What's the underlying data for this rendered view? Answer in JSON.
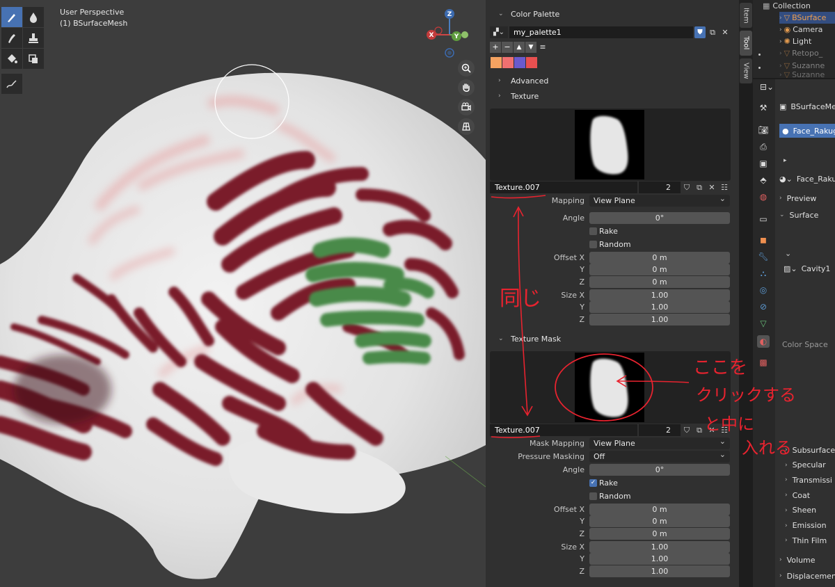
{
  "viewport": {
    "view_name": "User Perspective",
    "object_name": "(1) BSurfaceMesh",
    "gizmo": {
      "z": "Z",
      "x": "X",
      "y": "Y"
    }
  },
  "props": {
    "color_palette": {
      "header": "Color Palette",
      "palette_name": "my_palette1",
      "swatches": [
        "#f4a261",
        "#f07070",
        "#6a5acd",
        "#e85050"
      ]
    },
    "advanced": "Advanced",
    "texture": {
      "header": "Texture",
      "tex_name": "Texture.007",
      "users": "2",
      "mapping_label": "Mapping",
      "mapping_value": "View Plane",
      "angle_label": "Angle",
      "angle_value": "0°",
      "rake": "Rake",
      "random": "Random",
      "offset_x_label": "Offset X",
      "y_label": "Y",
      "z_label": "Z",
      "size_x_label": "Size X",
      "offset": [
        "0 m",
        "0 m",
        "0 m"
      ],
      "size": [
        "1.00",
        "1.00",
        "1.00"
      ]
    },
    "texture_mask": {
      "header": "Texture Mask",
      "tex_name": "Texture.007",
      "users": "2",
      "mask_mapping_label": "Mask Mapping",
      "mask_mapping_value": "View Plane",
      "pressure_label": "Pressure Masking",
      "pressure_value": "Off",
      "angle_label": "Angle",
      "angle_value": "0°",
      "rake": "Rake",
      "random": "Random",
      "offset_x_label": "Offset X",
      "y_label": "Y",
      "z_label": "Z",
      "size_x_label": "Size X",
      "offset": [
        "0 m",
        "0 m",
        "0 m"
      ],
      "size": [
        "1.00",
        "1.00",
        "1.00"
      ]
    },
    "tabs": [
      "Item",
      "Tool",
      "View"
    ]
  },
  "outliner": {
    "items": [
      "Collection",
      "BSurface",
      "Camera",
      "Light",
      "Retopo_",
      "Suzanne",
      "Suzanne"
    ]
  },
  "right": {
    "object": "BSurfaceMes",
    "material": "Face_Rakug",
    "material2": "Face_Raku",
    "preview": "Preview",
    "surface": "Surface",
    "cavity": "Cavity1",
    "color_space": "Color Space",
    "subsections": [
      "Subsurface",
      "Specular",
      "Transmissi",
      "Coat",
      "Sheen",
      "Emission",
      "Thin Film"
    ],
    "volume": "Volume",
    "displacement": "Displacement"
  },
  "annotations": {
    "same": "同じ",
    "click_here": [
      "ここを",
      "クリックする",
      "と中に",
      "入れる"
    ]
  }
}
